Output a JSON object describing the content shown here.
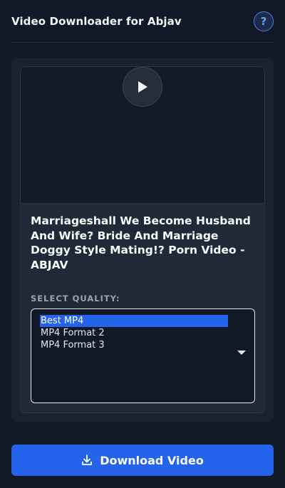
{
  "header": {
    "title": "Video Downloader for Abjav",
    "help_label": "?",
    "help_icon": "help-icon"
  },
  "video": {
    "play_icon": "play-icon",
    "title": "Marriageshall We Become Husband And Wife? Bride And Marriage Doggy Style Mating!? Porn Video - ABJAV"
  },
  "quality": {
    "label": "SELECT QUALITY:",
    "options": [
      "Best MP4",
      "MP4 Format 2",
      "MP4 Format 3"
    ],
    "selected": "Best MP4",
    "dropdown_icon": "chevron-down-icon"
  },
  "download": {
    "label": "Download Video",
    "icon": "download-icon"
  },
  "colors": {
    "background": "#111827",
    "accent": "#2563eb",
    "card": "#1f2937"
  }
}
